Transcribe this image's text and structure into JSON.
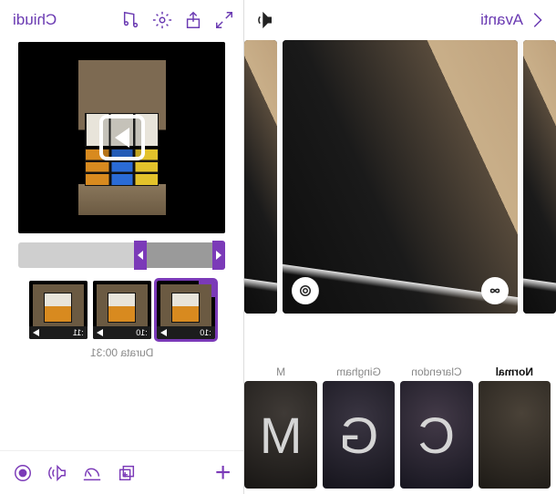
{
  "colors": {
    "accent": "#6a3ab2",
    "accent2": "#7b3ab8"
  },
  "left": {
    "back_label": "Avanti",
    "title": "",
    "sound_icon": "speaker-icon",
    "preview_badges": {
      "left": "infinity-icon",
      "right": "fit-icon"
    },
    "filters": [
      {
        "id": "normal",
        "label": "Normal",
        "glyph": "",
        "active": true
      },
      {
        "id": "clarendon",
        "label": "Clarendon",
        "glyph": "C",
        "active": false
      },
      {
        "id": "gingham",
        "label": "Gingham",
        "glyph": "G",
        "active": false
      },
      {
        "id": "moon",
        "label": "M",
        "glyph": "M",
        "active": false
      }
    ]
  },
  "right": {
    "close_label": "Chiudi",
    "header_icons": [
      "fullscreen-icon",
      "share-icon",
      "settings-icon",
      "music-icon"
    ],
    "trimmer": {
      "start_pct": 0,
      "end_pct": 38
    },
    "clips": [
      {
        "duration": ":10",
        "selected": true
      },
      {
        "duration": ":10",
        "selected": false
      },
      {
        "duration": ":11",
        "selected": false
      }
    ],
    "total_duration_label": "Durata",
    "total_duration_value": "00:31",
    "toolbar": {
      "add_label": "+",
      "icons": [
        "duplicate-icon",
        "speed-icon",
        "audio-icon",
        "record-icon"
      ]
    }
  }
}
